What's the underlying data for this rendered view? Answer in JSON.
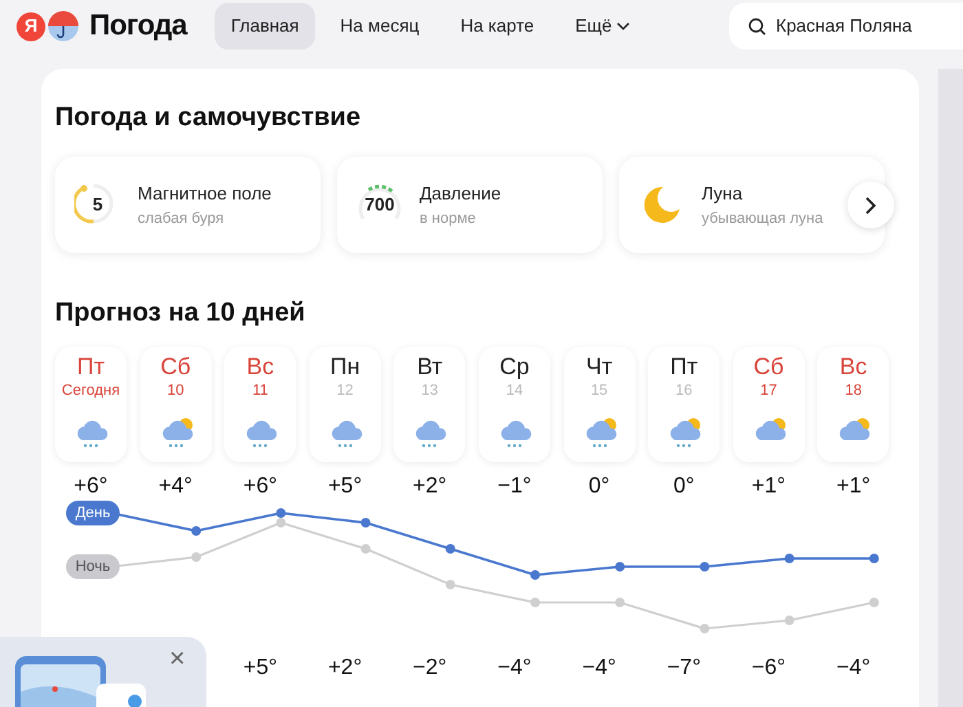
{
  "header": {
    "logo_letter": "Я",
    "brand": "Погода",
    "nav": [
      {
        "label": "Главная",
        "selected": true
      },
      {
        "label": "На месяц",
        "selected": false
      },
      {
        "label": "На карте",
        "selected": false
      },
      {
        "label": "Ещё",
        "selected": false,
        "dropdown": true
      }
    ],
    "search": {
      "value": "Красная Поляна"
    }
  },
  "wellness": {
    "title": "Погода и самочувствие",
    "cards": [
      {
        "kind": "magnetic",
        "value": "5",
        "title": "Магнитное поле",
        "subtitle": "слабая буря"
      },
      {
        "kind": "pressure",
        "value": "700",
        "title": "Давление",
        "subtitle": "в норме"
      },
      {
        "kind": "moon",
        "title": "Луна",
        "subtitle": "убывающая луна"
      }
    ]
  },
  "forecast": {
    "title": "Прогноз на 10 дней",
    "day_label": "День",
    "night_label": "Ночь",
    "days": [
      {
        "weekday": "Пт",
        "date": "Сегодня",
        "weekend": true,
        "kind": "snow",
        "day": "+6°"
      },
      {
        "weekday": "Сб",
        "date": "10",
        "weekend": true,
        "kind": "sun-snow",
        "day": "+4°"
      },
      {
        "weekday": "Вс",
        "date": "11",
        "weekend": true,
        "kind": "snow",
        "day": "+6°",
        "night": "+5°"
      },
      {
        "weekday": "Пн",
        "date": "12",
        "weekend": false,
        "kind": "snow",
        "day": "+5°",
        "night": "+2°"
      },
      {
        "weekday": "Вт",
        "date": "13",
        "weekend": false,
        "kind": "snow",
        "day": "+2°",
        "night": "−2°"
      },
      {
        "weekday": "Ср",
        "date": "14",
        "weekend": false,
        "kind": "snow",
        "day": "−1°",
        "night": "−4°"
      },
      {
        "weekday": "Чт",
        "date": "15",
        "weekend": false,
        "kind": "sun-snow",
        "day": "0°",
        "night": "−4°"
      },
      {
        "weekday": "Пт",
        "date": "16",
        "weekend": false,
        "kind": "sun-snow",
        "day": "0°",
        "night": "−7°"
      },
      {
        "weekday": "Сб",
        "date": "17",
        "weekend": true,
        "kind": "sun-cloud",
        "day": "+1°",
        "night": "−6°"
      },
      {
        "weekday": "Вс",
        "date": "18",
        "weekend": true,
        "kind": "sun-cloud",
        "day": "+1°",
        "night": "−4°"
      }
    ]
  },
  "promo": {
    "close": "×"
  }
}
